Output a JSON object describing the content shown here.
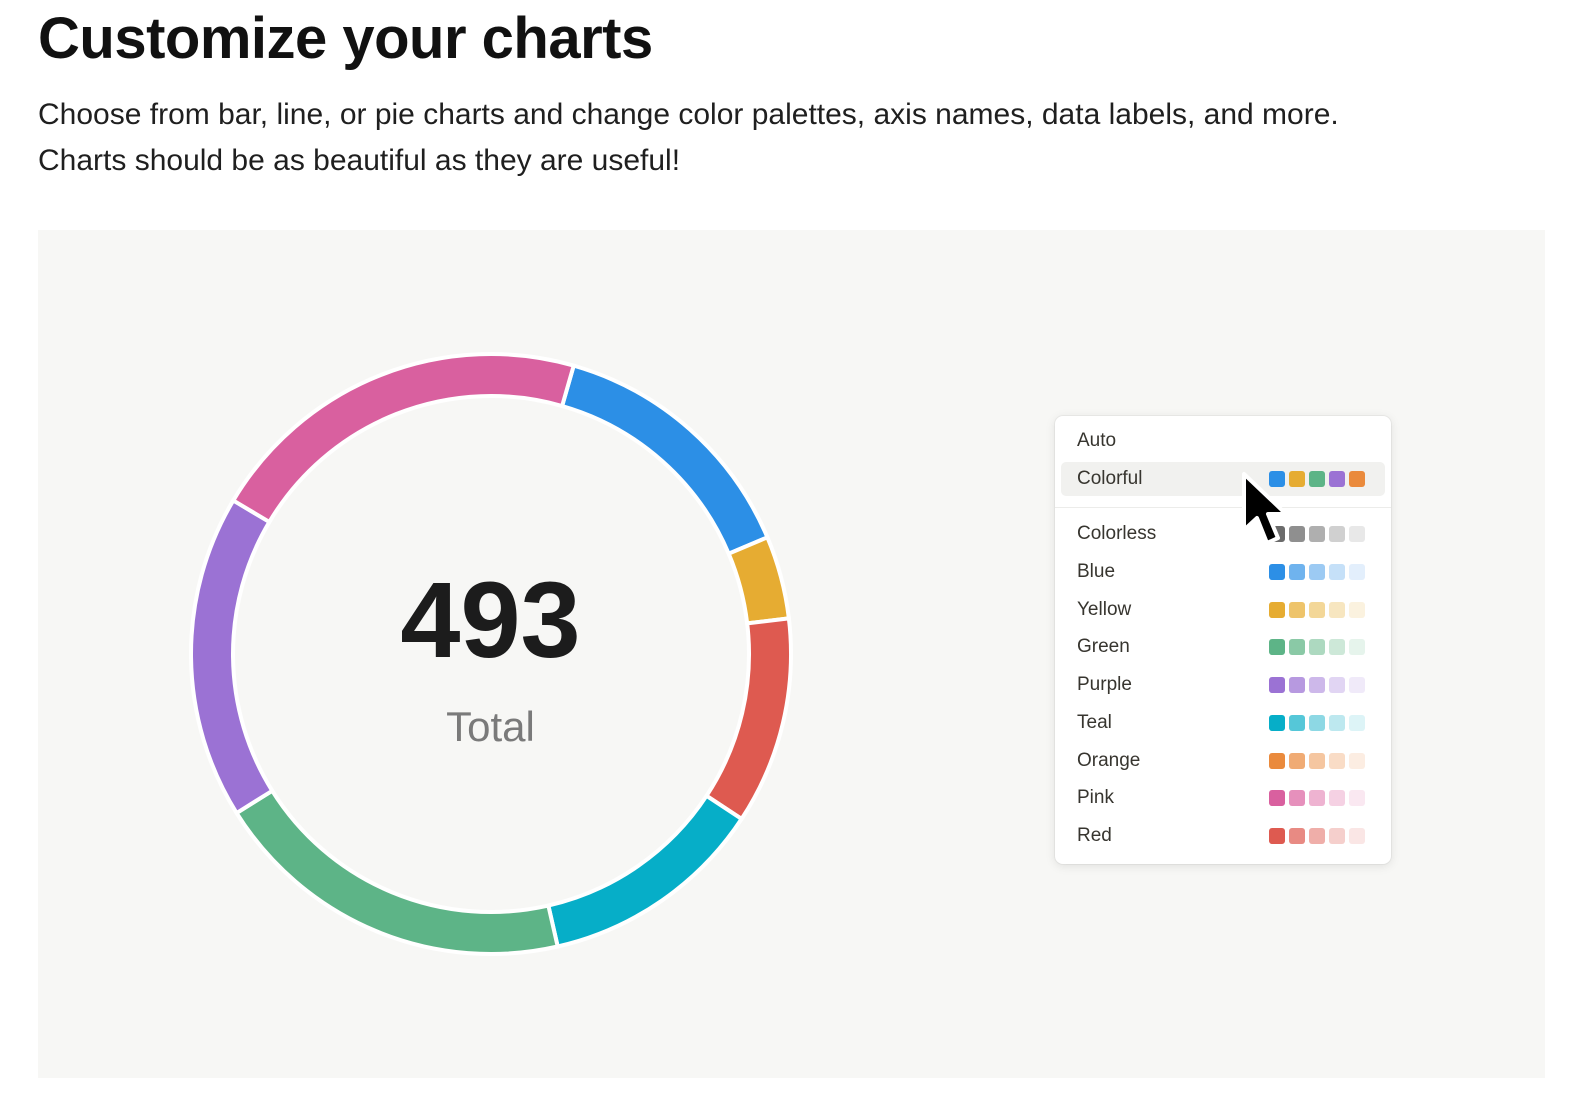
{
  "header": {
    "title": "Customize your charts",
    "description_line1": "Choose from bar, line, or pie charts and change color palettes, axis names, data labels, and more.",
    "description_line2": "Charts should be as beautiful as they are useful!"
  },
  "chart_data": {
    "type": "pie",
    "center_value": "493",
    "center_label": "Total",
    "slices": [
      {
        "value": 70,
        "color": "#2c8fe6"
      },
      {
        "value": 22,
        "color": "#e6ac32"
      },
      {
        "value": 55,
        "color": "#de5a50"
      },
      {
        "value": 60,
        "color": "#06aec8"
      },
      {
        "value": 97,
        "color": "#5db487"
      },
      {
        "value": 86,
        "color": "#9b72d4"
      },
      {
        "value": 103,
        "color": "#d9609f"
      }
    ]
  },
  "palette_menu": {
    "items": [
      {
        "label": "Auto",
        "swatches": []
      },
      {
        "label": "Colorful",
        "selected": true,
        "swatches": [
          "#2c8fe6",
          "#e6ac32",
          "#5db487",
          "#9b72d4",
          "#ea8a3c"
        ]
      },
      {
        "label": "Colorless",
        "swatches": [
          "#6b6b6b",
          "#8f8f8f",
          "#afafaf",
          "#d0d0d0",
          "#e8e8e8"
        ]
      },
      {
        "label": "Blue",
        "swatches": [
          "#2c8fe6",
          "#6fb3ee",
          "#9ccaf3",
          "#c5e0f8",
          "#e3effc"
        ]
      },
      {
        "label": "Yellow",
        "swatches": [
          "#e6ac32",
          "#eec46b",
          "#f3d798",
          "#f7e6c0",
          "#fbf2df"
        ]
      },
      {
        "label": "Green",
        "swatches": [
          "#5db487",
          "#8ac9a6",
          "#add9c0",
          "#cde8d8",
          "#e6f4ec"
        ]
      },
      {
        "label": "Purple",
        "swatches": [
          "#9b72d4",
          "#b799e0",
          "#cdb8ea",
          "#e1d5f3",
          "#f0eaf9"
        ]
      },
      {
        "label": "Teal",
        "swatches": [
          "#06aec8",
          "#55c7d8",
          "#8dd8e4",
          "#bde8ef",
          "#ddf4f7"
        ]
      },
      {
        "label": "Orange",
        "swatches": [
          "#ea8a3c",
          "#f0ab74",
          "#f5c6a0",
          "#f9dcc6",
          "#fcede2"
        ]
      },
      {
        "label": "Pink",
        "swatches": [
          "#d9609f",
          "#e690bc",
          "#eeb3d1",
          "#f5d1e3",
          "#fae8f1"
        ]
      },
      {
        "label": "Red",
        "swatches": [
          "#de5a50",
          "#e88a83",
          "#efaea9",
          "#f5cfcc",
          "#fae6e5"
        ]
      }
    ]
  }
}
